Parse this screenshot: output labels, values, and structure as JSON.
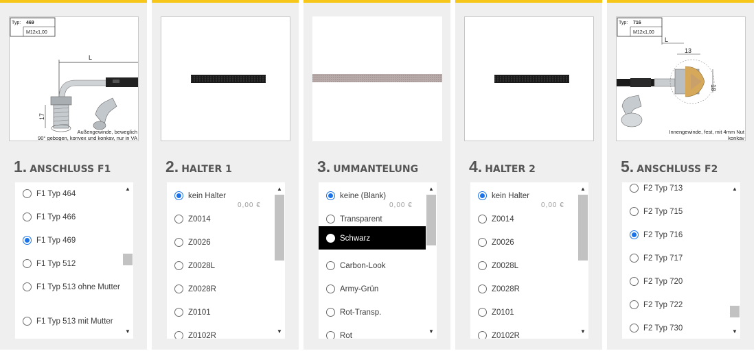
{
  "colors": {
    "accent": "#f6c618",
    "radio_selected": "#1a73e8",
    "selected_row_dark": "#000000"
  },
  "steps": [
    {
      "num": "1.",
      "title": "ANSCHLUSS F1",
      "image": {
        "typ_label": "Typ:",
        "typ_value": "469",
        "thread": "M12x1,00",
        "dim_L": "L",
        "dim_17": "17",
        "caption_line1": "Außengewinde, beweglich",
        "caption_line2": "90° gebogen, konvex und konkav, nur in VA"
      },
      "options": [
        {
          "label": "F1 Typ 464",
          "selected": false
        },
        {
          "label": "F1 Typ 466",
          "selected": false
        },
        {
          "label": "F1 Typ 469",
          "selected": true
        },
        {
          "label": "F1 Typ 512",
          "selected": false
        },
        {
          "label": "F1 Typ 513 ohne Mutter",
          "selected": false
        },
        {
          "label": "F1 Typ 513 mit Mutter",
          "selected": false
        }
      ]
    },
    {
      "num": "2.",
      "title": "HALTER 1",
      "options": [
        {
          "label": "kein Halter",
          "selected": true,
          "price": "0,00 €"
        },
        {
          "label": "Z0014",
          "selected": false
        },
        {
          "label": "Z0026",
          "selected": false
        },
        {
          "label": "Z0028L",
          "selected": false
        },
        {
          "label": "Z0028R",
          "selected": false
        },
        {
          "label": "Z0101",
          "selected": false
        },
        {
          "label": "Z0102R",
          "selected": false
        }
      ]
    },
    {
      "num": "3.",
      "title": "UMMANTELUNG",
      "options": [
        {
          "label": "keine (Blank)",
          "selected": true,
          "price": "0,00 €"
        },
        {
          "label": "Transparent",
          "selected": false
        },
        {
          "label": "Schwarz",
          "selected": false,
          "highlighted": true
        },
        {
          "label": "Carbon-Look",
          "selected": false
        },
        {
          "label": "Army-Grün",
          "selected": false
        },
        {
          "label": "Rot-Transp.",
          "selected": false
        },
        {
          "label": "Rot",
          "selected": false
        }
      ]
    },
    {
      "num": "4.",
      "title": "HALTER 2",
      "options": [
        {
          "label": "kein Halter",
          "selected": true,
          "price": "0,00 €"
        },
        {
          "label": "Z0014",
          "selected": false
        },
        {
          "label": "Z0026",
          "selected": false
        },
        {
          "label": "Z0028L",
          "selected": false
        },
        {
          "label": "Z0028R",
          "selected": false
        },
        {
          "label": "Z0101",
          "selected": false
        },
        {
          "label": "Z0102R",
          "selected": false
        }
      ]
    },
    {
      "num": "5.",
      "title": "ANSCHLUSS F2",
      "image": {
        "typ_label": "Typ:",
        "typ_value": "716",
        "thread": "M12x1,00",
        "dim_L": "L",
        "dim_13": "13",
        "dim_18": "18",
        "caption_line1": "Innengewinde, fest, mit 4mm Nut",
        "caption_line2": "konkav"
      },
      "options": [
        {
          "label": "F2 Typ 713",
          "selected": false
        },
        {
          "label": "F2 Typ 715",
          "selected": false
        },
        {
          "label": "F2 Typ 716",
          "selected": true
        },
        {
          "label": "F2 Typ 717",
          "selected": false
        },
        {
          "label": "F2 Typ 720",
          "selected": false
        },
        {
          "label": "F2 Typ 722",
          "selected": false
        },
        {
          "label": "F2 Typ 730",
          "selected": false
        }
      ]
    }
  ]
}
